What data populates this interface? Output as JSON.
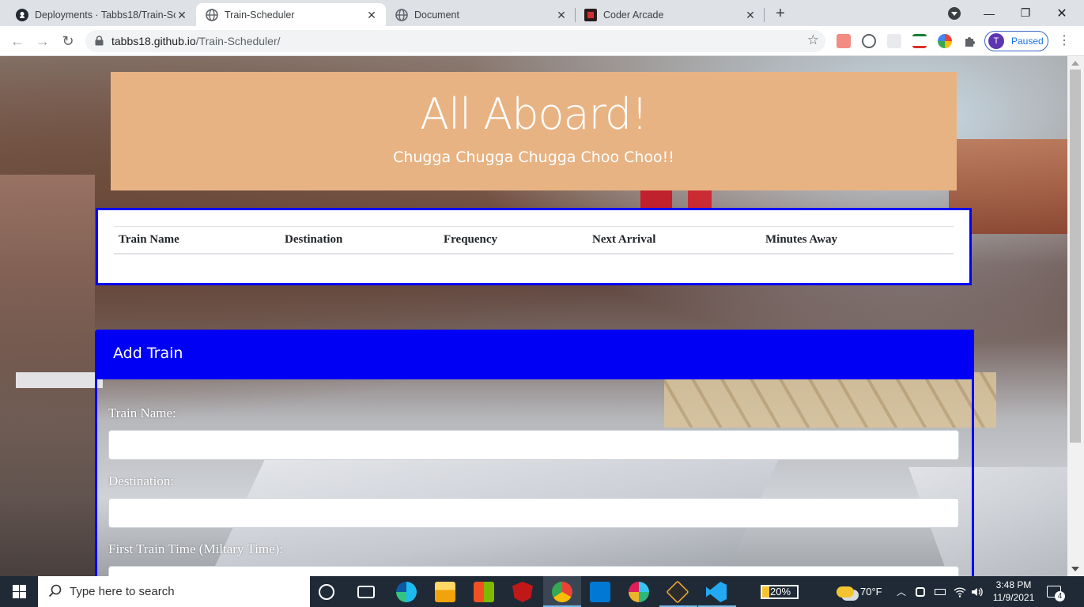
{
  "browser": {
    "tabs": [
      {
        "title": "Deployments · Tabbs18/Train-Sch",
        "icon": "github-icon",
        "active": false
      },
      {
        "title": "Train-Scheduler",
        "icon": "globe-icon",
        "active": true
      },
      {
        "title": "Document",
        "icon": "globe-icon",
        "active": false
      },
      {
        "title": "Coder Arcade",
        "icon": "coder-arcade-icon",
        "active": false
      }
    ],
    "url_host": "tabbs18.github.io",
    "url_path": "/Train-Scheduler/",
    "profile_initial": "T",
    "profile_label": "Paused"
  },
  "page": {
    "title": "All Aboard!",
    "subtitle": "Chugga Chugga Chugga Choo Choo!!",
    "table_headers": [
      "Train Name",
      "Destination",
      "Frequency",
      "Next Arrival",
      "Minutes Away"
    ],
    "form": {
      "heading": "Add Train",
      "fields": [
        {
          "label": "Train Name:",
          "value": ""
        },
        {
          "label": "Destination:",
          "value": ""
        },
        {
          "label": "First Train Time (Miltary Time):",
          "value": ""
        }
      ]
    },
    "colors": {
      "jumbotron": "#e8b383",
      "accent": "#0000f5"
    }
  },
  "taskbar": {
    "search_placeholder": "Type here to search",
    "battery": "20%",
    "weather": "70°F",
    "time": "3:48 PM",
    "date": "11/9/2021",
    "notifications": "4"
  }
}
